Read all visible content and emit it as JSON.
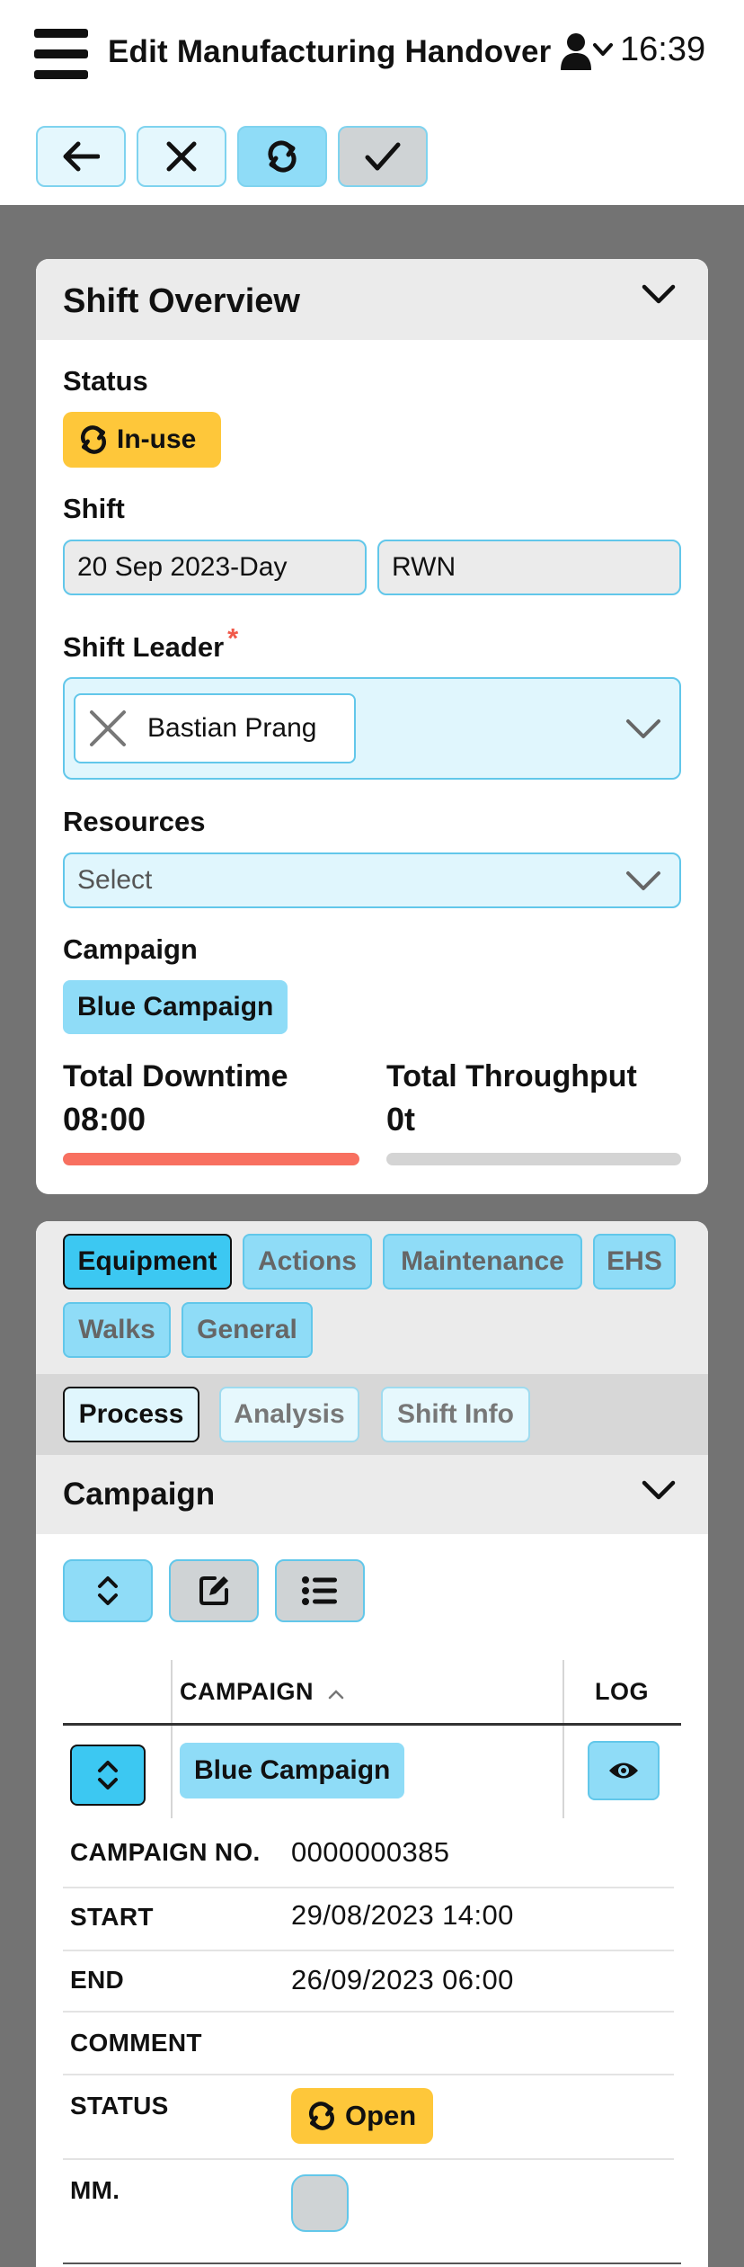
{
  "header": {
    "title": "Edit Manufacturing Handover",
    "time": "16:39"
  },
  "overview": {
    "title": "Shift Overview",
    "status_label": "Status",
    "status_value": "In-use",
    "shift_label": "Shift",
    "shift_date": "20 Sep 2023-Day",
    "shift_code": "RWN",
    "leader_label": "Shift Leader",
    "leader_required": "*",
    "leader_value": "Bastian Prang",
    "resources_label": "Resources",
    "resources_placeholder": "Select",
    "campaign_label": "Campaign",
    "campaign_value": "Blue Campaign",
    "downtime_label": "Total Downtime",
    "downtime_value": "08:00",
    "downtime_progress": 1.0,
    "throughput_label": "Total Throughput",
    "throughput_value": "0t",
    "throughput_progress": 0.0
  },
  "tabs": [
    "Equipment",
    "Actions",
    "Maintenance",
    "EHS",
    "Walks",
    "General"
  ],
  "subtabs": [
    "Process",
    "Analysis",
    "Shift Info"
  ],
  "campaign_section": {
    "title": "Campaign",
    "col_campaign": "CAMPAIGN",
    "col_log": "LOG",
    "row_campaign": "Blue Campaign",
    "details": {
      "campaign_no_key": "CAMPAIGN NO.",
      "campaign_no": "0000000385",
      "start_key": "START",
      "start": "29/08/2023 14:00",
      "end_key": "END",
      "end": "26/09/2023 06:00",
      "comment_key": "COMMENT",
      "status_key": "STATUS",
      "status": "Open",
      "mm_key": "MM."
    }
  },
  "colors": {
    "accent": "#3cc8f2",
    "chip": "#8fdcf7",
    "warning": "#fec73a",
    "downtime": "#f87060",
    "track": "#d4d4d4"
  }
}
